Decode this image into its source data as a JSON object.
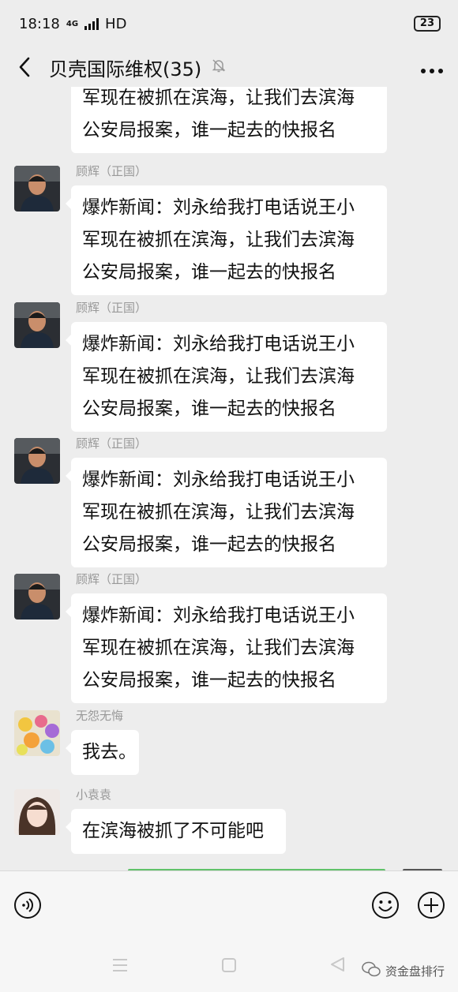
{
  "status": {
    "time": "18:18",
    "network": "4G",
    "hd": "HD",
    "battery": "23"
  },
  "header": {
    "title": "贝壳国际维权",
    "count": "(35)"
  },
  "messages": [
    {
      "sender": "",
      "lines": [
        "军现在被抓在滨海，让我们去滨海",
        "公安局报案，谁一起去的快报名"
      ]
    },
    {
      "sender": "顾辉（正国）",
      "lines": [
        "爆炸新闻：刘永给我打电话说王小",
        "军现在被抓在滨海，让我们去滨海",
        "公安局报案，谁一起去的快报名"
      ]
    },
    {
      "sender": "顾辉（正国）",
      "lines": [
        "爆炸新闻：刘永给我打电话说王小",
        "军现在被抓在滨海，让我们去滨海",
        "公安局报案，谁一起去的快报名"
      ]
    },
    {
      "sender": "顾辉（正国）",
      "lines": [
        "爆炸新闻：刘永给我打电话说王小",
        "军现在被抓在滨海，让我们去滨海",
        "公安局报案，谁一起去的快报名"
      ]
    },
    {
      "sender": "顾辉（正国）",
      "lines": [
        "爆炸新闻：刘永给我打电话说王小",
        "军现在被抓在滨海，让我们去滨海",
        "公安局报案，谁一起去的快报名"
      ]
    },
    {
      "sender": "无怨无悔",
      "lines": [
        "我去。"
      ]
    },
    {
      "sender": "小袁袁",
      "lines": [
        "在滨海被抓了不可能吧"
      ]
    }
  ],
  "icons": {
    "back": "back-arrow-icon",
    "mute": "mute-bell-icon",
    "more": "more-dots-icon",
    "voice": "voice-icon",
    "emoji": "emoji-icon",
    "add": "add-icon"
  },
  "watermark": "资金盘排行"
}
